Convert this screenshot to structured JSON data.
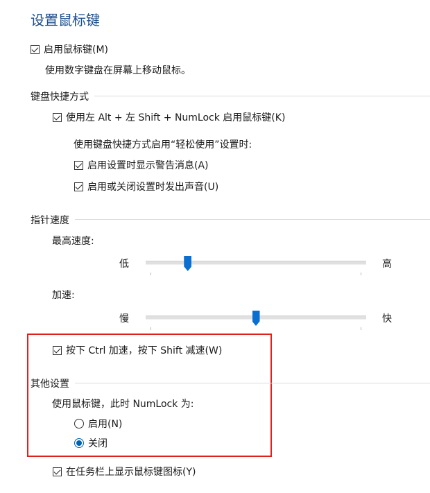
{
  "title": "设置鼠标键",
  "enable_mousekeys": {
    "label": "启用鼠标键(M)",
    "checked": true
  },
  "enable_desc": "使用数字键盘在屏幕上移动鼠标。",
  "keyboard_shortcut": {
    "heading": "键盘快捷方式",
    "shortcut_toggle": {
      "label": "使用左 Alt + 左 Shift + NumLock 启用鼠标键(K)",
      "checked": true
    },
    "sub_desc": "使用键盘快捷方式启用“轻松使用”设置时:",
    "warning": {
      "label": "启用设置时显示警告消息(A)",
      "checked": true
    },
    "sound": {
      "label": "启用或关闭设置时发出声音(U)",
      "checked": true
    }
  },
  "pointer_speed": {
    "heading": "指针速度",
    "top_speed": {
      "label": "最高速度:",
      "low": "低",
      "high": "高",
      "value": 0.18
    },
    "acceleration": {
      "label": "加速:",
      "low": "慢",
      "high": "快",
      "value": 0.5
    },
    "ctrl_shift": {
      "label": "按下 Ctrl 加速，按下 Shift 减速(W)",
      "checked": true
    }
  },
  "other": {
    "heading": "其他设置",
    "numlock_desc": "使用鼠标键，此时 NumLock 为:",
    "on": {
      "label": "启用(N)",
      "selected": false
    },
    "off": {
      "label": "关闭",
      "selected": true
    },
    "taskbar_icon": {
      "label": "在任务栏上显示鼠标键图标(Y)",
      "checked": true
    }
  },
  "colors": {
    "accent": "#0a6fd1",
    "title": "#1f4e8c",
    "highlight": "#e0201d"
  }
}
